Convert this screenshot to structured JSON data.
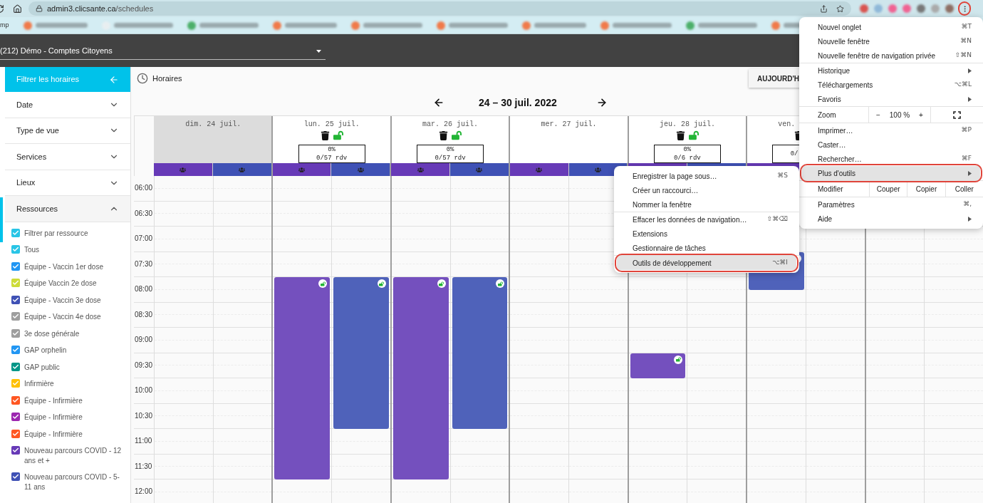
{
  "browser": {
    "url_host": "admin3.clicsante.ca",
    "url_path": "/schedules",
    "bookmark_fragment": "mp"
  },
  "app_header": {
    "organization": "(212) Démo - Comptes Citoyens"
  },
  "filter_panel": {
    "title": "Filtrer les horaires",
    "sections": [
      {
        "label": "Date",
        "expanded": false
      },
      {
        "label": "Type de vue",
        "expanded": false
      },
      {
        "label": "Services",
        "expanded": false
      },
      {
        "label": "Lieux",
        "expanded": false
      },
      {
        "label": "Ressources",
        "expanded": true
      }
    ],
    "resources": [
      {
        "label": "Filtrer par ressource",
        "checked": true,
        "color": "#29c5e6"
      },
      {
        "label": "Tous",
        "checked": true,
        "color": "#29c5e6"
      },
      {
        "label": "Équipe - Vaccin 1er dose",
        "checked": true,
        "color": "#2196f3"
      },
      {
        "label": "Équipe Vaccin 2e dose",
        "checked": true,
        "color": "#cddc39"
      },
      {
        "label": "Équipe - Vaccin 3e dose",
        "checked": true,
        "color": "#3f51b5"
      },
      {
        "label": "Équipe - Vaccin 4e dose",
        "checked": true,
        "color": "#9e9e9e"
      },
      {
        "label": "3e dose générale",
        "checked": true,
        "color": "#9e9e9e"
      },
      {
        "label": "GAP orphelin",
        "checked": true,
        "color": "#2196f3"
      },
      {
        "label": "GAP public",
        "checked": true,
        "color": "#009688"
      },
      {
        "label": "Infirmière",
        "checked": true,
        "color": "#ffc107"
      },
      {
        "label": "Équipe - Infirmière",
        "checked": true,
        "color": "#ff5722"
      },
      {
        "label": "Équipe - Infirmière",
        "checked": true,
        "color": "#9c27b0"
      },
      {
        "label": "Équipe - Infirmière",
        "checked": true,
        "color": "#ff5722"
      },
      {
        "label": "Nouveau parcours COVID - 12 ans et +",
        "checked": true,
        "color": "#673ab7"
      },
      {
        "label": "Nouveau parcours COVID - 5-11 ans",
        "checked": true,
        "color": "#3f51b5"
      }
    ]
  },
  "page": {
    "title": "Horaires",
    "today_button": "AUJOURD'H",
    "range": "24 – 30 juil. 2022"
  },
  "calendar": {
    "resource_columns": [
      {
        "color": "#673ab7"
      },
      {
        "color": "#3f51b5"
      }
    ],
    "times": [
      "06:00",
      "06:30",
      "07:00",
      "07:30",
      "08:00",
      "08:30",
      "09:00",
      "09:30",
      "10:00",
      "10:30",
      "11:00",
      "11:30",
      "12:00"
    ],
    "days": [
      {
        "label": "dim. 24 juil.",
        "past": true,
        "trash": false,
        "lock": false
      },
      {
        "label": "lun. 25 juil.",
        "past": false,
        "trash": true,
        "lock": true,
        "percent": "0%",
        "count": "0/57 rdv",
        "blocks": [
          {
            "color": "#7450be"
          },
          {
            "color": "#4f62ba"
          }
        ]
      },
      {
        "label": "mar. 26 juil.",
        "past": false,
        "trash": true,
        "lock": true,
        "percent": "0%",
        "count": "0/57 rdv",
        "blocks": [
          {
            "color": "#7450be"
          },
          {
            "color": "#4f62ba"
          }
        ]
      },
      {
        "label": "mer. 27 juil.",
        "past": false,
        "trash": false,
        "lock": false
      },
      {
        "label": "jeu. 28 juil.",
        "past": false,
        "trash": true,
        "lock": true,
        "percent": "0%",
        "count": "0/6 rdv",
        "blocks": [
          {
            "color": "#7450be"
          }
        ]
      },
      {
        "label": "ven.",
        "past": false,
        "trash": true,
        "lock": false,
        "count": "0/",
        "blocks": [
          {
            "color": "#4f62ba"
          }
        ]
      }
    ]
  },
  "browser_menu": {
    "groups": [
      [
        {
          "kind": "item",
          "label": "Nouvel onglet",
          "shortcut": "⌘T",
          "submenu": false,
          "selected": false
        },
        {
          "kind": "item",
          "label": "Nouvelle fenêtre",
          "shortcut": "⌘N",
          "submenu": false,
          "selected": false
        },
        {
          "kind": "item",
          "label": "Nouvelle fenêtre de navigation privée",
          "shortcut": "⇧⌘N",
          "submenu": false,
          "selected": false
        }
      ],
      [
        {
          "kind": "item",
          "label": "Historique",
          "submenu": true,
          "selected": false
        },
        {
          "kind": "item",
          "label": "Téléchargements",
          "shortcut": "⌥⌘L",
          "submenu": false,
          "selected": false
        },
        {
          "kind": "item",
          "label": "Favoris",
          "submenu": true,
          "selected": false
        }
      ],
      [
        {
          "kind": "zoom",
          "label": "Zoom",
          "minus": "−",
          "value": "100 %",
          "plus": "+"
        }
      ],
      [
        {
          "kind": "item",
          "label": "Imprimer…",
          "shortcut": "⌘P",
          "submenu": false,
          "selected": false
        },
        {
          "kind": "item",
          "label": "Caster…",
          "submenu": false,
          "selected": false
        },
        {
          "kind": "item",
          "label": "Rechercher…",
          "shortcut": "⌘F",
          "submenu": false,
          "selected": false
        },
        {
          "kind": "item",
          "label": "Plus d'outils",
          "submenu": true,
          "selected": true
        }
      ],
      [
        {
          "kind": "edit",
          "label": "Modifier",
          "actions": [
            "Couper",
            "Copier",
            "Coller"
          ]
        }
      ],
      [
        {
          "kind": "item",
          "label": "Paramètres",
          "shortcut": "⌘,",
          "submenu": false,
          "selected": false
        },
        {
          "kind": "item",
          "label": "Aide",
          "submenu": true,
          "selected": false
        }
      ]
    ]
  },
  "tools_submenu": {
    "groups": [
      [
        {
          "kind": "item",
          "label": "Enregistrer la page sous…",
          "shortcut": "⌘S",
          "submenu": false,
          "selected": false
        },
        {
          "kind": "item",
          "label": "Créer un raccourci…",
          "submenu": false,
          "selected": false
        },
        {
          "kind": "item",
          "label": "Nommer la fenêtre",
          "submenu": false,
          "selected": false
        }
      ],
      [
        {
          "kind": "item",
          "label": "Effacer les données de navigation…",
          "shortcut": "⇧⌘⌫",
          "submenu": false,
          "selected": false
        },
        {
          "kind": "item",
          "label": "Extensions",
          "submenu": false,
          "selected": false
        },
        {
          "kind": "item",
          "label": "Gestionnaire de tâches",
          "submenu": false,
          "selected": false
        }
      ],
      [
        {
          "kind": "item",
          "label": "Outils de développement",
          "shortcut": "⌥⌘I",
          "submenu": false,
          "selected": true
        }
      ]
    ]
  }
}
